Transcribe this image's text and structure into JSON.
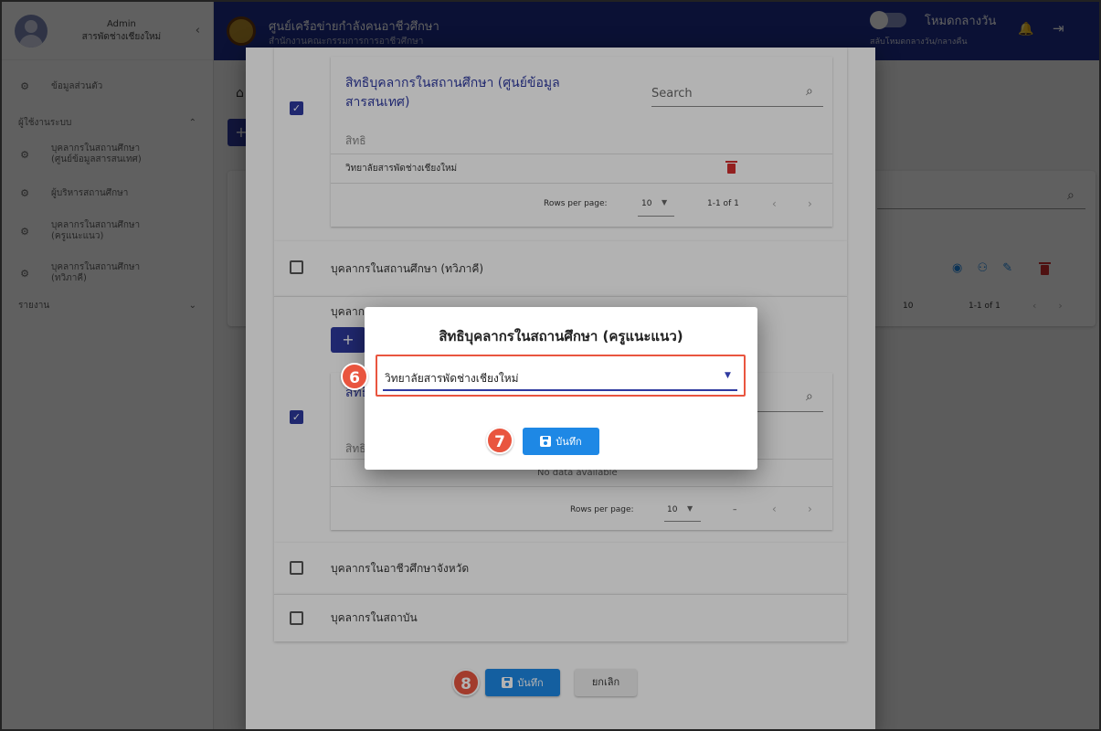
{
  "sidebar": {
    "user_role": "Admin",
    "user_org": "สารพัดช่างเชียงใหม่",
    "profile": "ข้อมูลส่วนตัว",
    "section_users": "ผู้ใช้งานระบบ",
    "items": [
      {
        "line1": "บุคลากรในสถานศึกษา",
        "line2": "(ศูนย์ข้อมูลสารสนเทศ)"
      },
      {
        "line1": "ผู้บริหารสถานศึกษา",
        "line2": ""
      },
      {
        "line1": "บุคลากรในสถานศึกษา",
        "line2": "(ครูแนะแนว)"
      },
      {
        "line1": "บุคลากรในสถานศึกษา",
        "line2": "(ทวิภาคี)"
      }
    ],
    "section_reports": "รายงาน"
  },
  "topbar": {
    "title": "ศูนย์เครือข่ายกำลังคนอาชีวศึกษา",
    "subtitle": "สำนักงานคณะกรรมการการอาชีวศึกษา",
    "mode_label": "โหมดกลางวัน",
    "mode_sub": "สลับโหมดกลางวัน/กลางคืน"
  },
  "background": {
    "rows_per_page": "10",
    "range": "1-1 of 1"
  },
  "dialog": {
    "panels": [
      {
        "title_line1": "สิทธิบุคลากรในสถานศึกษา (ศูนย์ข้อมูล",
        "title_line2": "สารสนเทศ)",
        "search_placeholder": "Search",
        "column": "สิทธิ",
        "row": "วิทยาลัยสารพัดช่างเชียงใหม่",
        "rows_per_page_label": "Rows per page:",
        "rows_per_page": "10",
        "range": "1-1 of 1",
        "checked": true
      },
      {
        "label": "บุคลากรในสถานศึกษา (ทวิภาคี)",
        "checked": false
      },
      {
        "label_partial": "บุคลาก",
        "title_partial": "สิทธิ",
        "column_partial": "สิทธิ",
        "empty": "No data available",
        "rows_per_page_label": "Rows per page:",
        "rows_per_page": "10",
        "range": "–",
        "checked": true
      },
      {
        "label": "บุคลากรในอาชีวศึกษาจังหวัด",
        "checked": false
      },
      {
        "label": "บุคลากรในสถาบัน",
        "checked": false
      }
    ],
    "save_label": "บันทึก",
    "cancel_label": "ยกเลิก"
  },
  "popup": {
    "title": "สิทธิบุคลากรในสถานศึกษา (ครูแนะแนว)",
    "selected": "วิทยาลัยสารพัดช่างเชียงใหม่",
    "save_label": "บันทึก"
  },
  "steps": [
    "6",
    "7",
    "8"
  ],
  "colors": {
    "primary": "#2f3aa0",
    "topbar": "#1f2f8c",
    "action": "#1e88e5",
    "danger": "#d32f2f",
    "step": "#e9553f"
  }
}
